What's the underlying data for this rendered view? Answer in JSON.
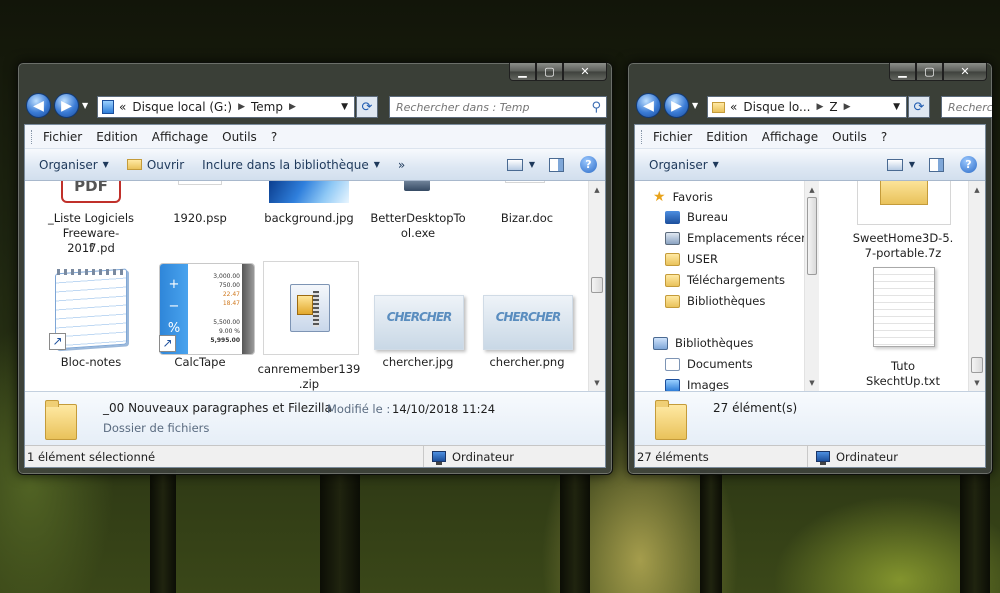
{
  "left_window": {
    "address": {
      "prefix": "«",
      "drive": "Disque local (G:)",
      "folder": "Temp"
    },
    "search_placeholder": "Rechercher dans : Temp",
    "menu": [
      "Fichier",
      "Edition",
      "Affichage",
      "Outils",
      "?"
    ],
    "commands": {
      "organize": "Organiser",
      "open": "Ouvrir",
      "include": "Inclure dans la bibliothèque",
      "more": "»"
    },
    "row1": [
      {
        "name": "_Liste Logiciels Freeware-2017.pdf",
        "line1": "_Liste Logiciels",
        "line2": "Freeware-2017.pd",
        "line3": "f",
        "badge": "PDF"
      },
      {
        "name": "1920.psp",
        "line1": "1920.psp"
      },
      {
        "name": "background.jpg",
        "line1": "background.jpg"
      },
      {
        "name": "BetterDesktopTool.exe",
        "line1": "BetterDesktopTo",
        "line2": "ol.exe"
      },
      {
        "name": "Bizar.doc",
        "line1": "Bizar.doc"
      }
    ],
    "row2": [
      {
        "name": "Bloc-notes",
        "line1": "Bloc-notes"
      },
      {
        "name": "CalcTape",
        "line1": "CalcTape",
        "tape": [
          "3,000.00",
          "750.00",
          "22.47",
          "18.47",
          "5,500.00",
          "9.00 %",
          "5,995.00"
        ],
        "ops": [
          "+",
          "−",
          "%"
        ]
      },
      {
        "name": "canremember139.zip",
        "line1": "canremember139",
        "line2": ".zip"
      },
      {
        "name": "chercher.jpg",
        "line1": "chercher.jpg",
        "logo": "CHERCHER"
      },
      {
        "name": "chercher.png",
        "line1": "chercher.png",
        "logo": "CHERCHER"
      }
    ],
    "details": {
      "name": "_00 Nouveaux paragraphes et Filezilla",
      "modified_label": "Modifié le :",
      "modified_value": "14/10/2018 11:24",
      "type": "Dossier de fichiers"
    },
    "status": {
      "selected": "1 élément sélectionné",
      "location": "Ordinateur"
    }
  },
  "right_window": {
    "address": {
      "prefix": "«",
      "drive": "Disque lo...",
      "folder": "Z"
    },
    "search_placeholder": "Recherc",
    "menu": [
      "Fichier",
      "Edition",
      "Affichage",
      "Outils",
      "?"
    ],
    "commands": {
      "organize": "Organiser"
    },
    "nav_tree": [
      {
        "label": "Favoris",
        "icon": "star-icon",
        "indent": 0
      },
      {
        "label": "Bureau",
        "icon": "desktop-icon",
        "indent": 1
      },
      {
        "label": "Emplacements récents",
        "icon": "recent-places-icon",
        "indent": 1
      },
      {
        "label": "USER",
        "icon": "user-folder-icon",
        "indent": 1
      },
      {
        "label": "Téléchargements",
        "icon": "downloads-icon",
        "indent": 1
      },
      {
        "label": "Bibliothèques",
        "icon": "libraries-icon",
        "indent": 1
      },
      {
        "label": "Bibliothèques",
        "icon": "libraries-icon",
        "indent": 0
      },
      {
        "label": "Documents",
        "icon": "documents-icon",
        "indent": 1
      },
      {
        "label": "Images",
        "icon": "images-icon",
        "indent": 1
      }
    ],
    "files": [
      {
        "name": "SweetHome3D-5.7-portable.7z",
        "line1": "SweetHome3D-5.",
        "line2": "7-portable.7z"
      },
      {
        "name": "Tuto SkechtUp.txt",
        "line1": "Tuto",
        "line2": "SkechtUp.txt"
      }
    ],
    "details": {
      "count": "27 élément(s)"
    },
    "status": {
      "count": "27 éléments",
      "location": "Ordinateur"
    }
  },
  "colors": {
    "accent": "#1e395b",
    "selection": "#cce8ff",
    "folder": "#e9c25b"
  }
}
